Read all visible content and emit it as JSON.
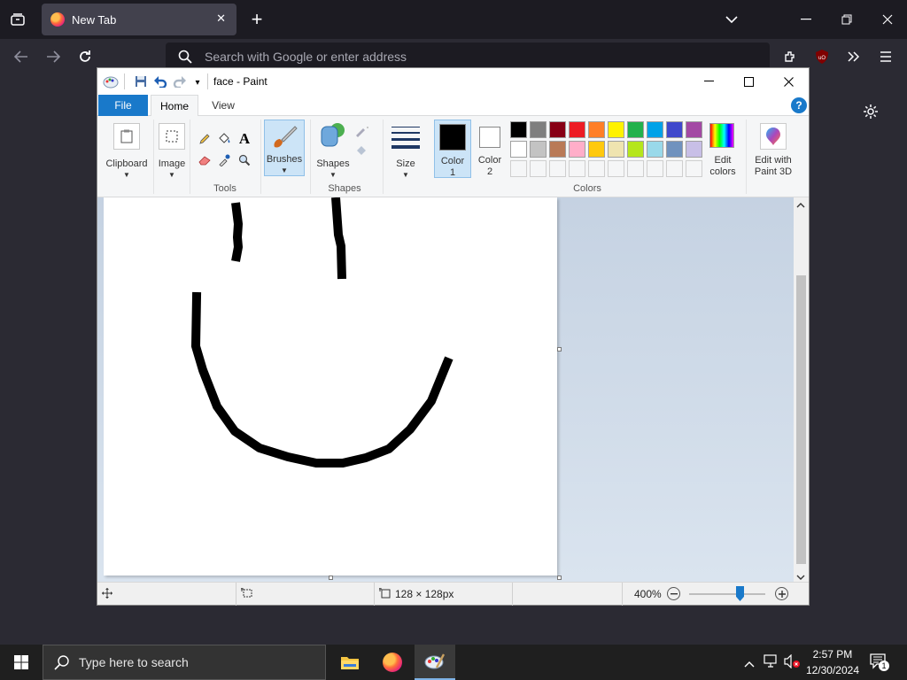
{
  "browser": {
    "tab_title": "New Tab",
    "new_tab": "+",
    "address_placeholder": "Search with Google or enter address",
    "ublock_badge": "uO"
  },
  "paint": {
    "title": "face - Paint",
    "tabs": {
      "file": "File",
      "home": "Home",
      "view": "View"
    },
    "groups": {
      "clipboard": "Clipboard",
      "image": "Image",
      "tools": "Tools",
      "brushes": "Brushes",
      "shapes": "Shapes",
      "shapes_group": "Shapes",
      "size": "Size",
      "color1": "Color 1",
      "color2": "Color 2",
      "colors": "Colors",
      "edit_colors": "Edit colors",
      "edit_paint3d": "Edit with Paint 3D"
    },
    "palette": {
      "row1": [
        "#000000",
        "#7f7f7f",
        "#880015",
        "#ed1c24",
        "#ff7f27",
        "#fff200",
        "#22b14c",
        "#00a2e8",
        "#3f48cc",
        "#a349a4"
      ],
      "row2": [
        "#ffffff",
        "#c3c3c3",
        "#b97a57",
        "#ffaec9",
        "#ffc90e",
        "#efe4b0",
        "#b5e61d",
        "#99d9ea",
        "#7092be",
        "#c8bfe7"
      ]
    },
    "status": {
      "image_size": "128 × 128px",
      "zoom": "400%"
    }
  },
  "taskbar": {
    "search_placeholder": "Type here to search",
    "time": "2:57 PM",
    "date": "12/30/2024",
    "notification_count": "1"
  }
}
